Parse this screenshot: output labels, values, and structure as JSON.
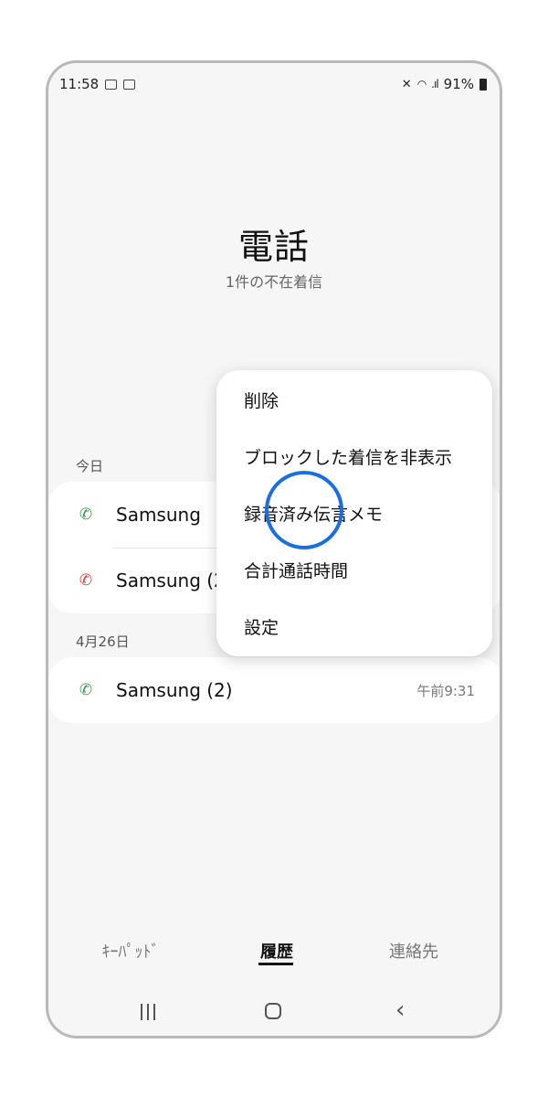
{
  "status_bar": {
    "time": "11:58",
    "battery": "91%"
  },
  "header": {
    "title": "電話",
    "subtitle": "1件の不在着信"
  },
  "sections": {
    "today_label": "今日",
    "apr26_label": "4月26日"
  },
  "calls": {
    "today": [
      {
        "name": "Samsung",
        "type": "incoming"
      },
      {
        "name": "Samsung (2)",
        "type": "missed"
      }
    ],
    "apr26": [
      {
        "name": "Samsung (2)",
        "type": "incoming",
        "time": "午前9:31"
      }
    ]
  },
  "menu": {
    "items": [
      "削除",
      "ブロックした着信を非表示",
      "録音済み伝言メモ",
      "合計通話時間",
      "設定"
    ]
  },
  "tabs": {
    "keypad": "ｷｰﾊﾟｯﾄﾞ",
    "history": "履歴",
    "contacts": "連絡先",
    "active": "history"
  },
  "colors": {
    "incoming": "#3a9a4a",
    "missed": "#e03c3c",
    "touch_indicator": "#1a6fe0"
  },
  "icons": {
    "incoming": "incoming-call-icon",
    "missed": "missed-call-icon"
  }
}
